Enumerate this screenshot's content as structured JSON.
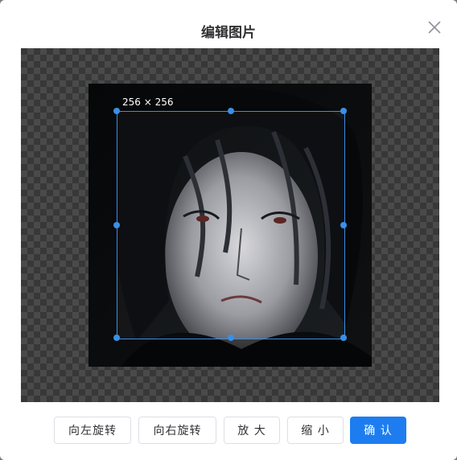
{
  "dialog": {
    "title": "编辑图片",
    "close_icon": "close-icon"
  },
  "cropper": {
    "dimension_label": "256 × 256"
  },
  "toolbar": {
    "rotate_left_label": "向左旋转",
    "rotate_right_label": "向右旋转",
    "zoom_in_label": "放 大",
    "zoom_out_label": "缩 小",
    "confirm_label": "确 认"
  },
  "colors": {
    "accent": "#1d7df0",
    "crop_border": "#3b8fe6"
  }
}
